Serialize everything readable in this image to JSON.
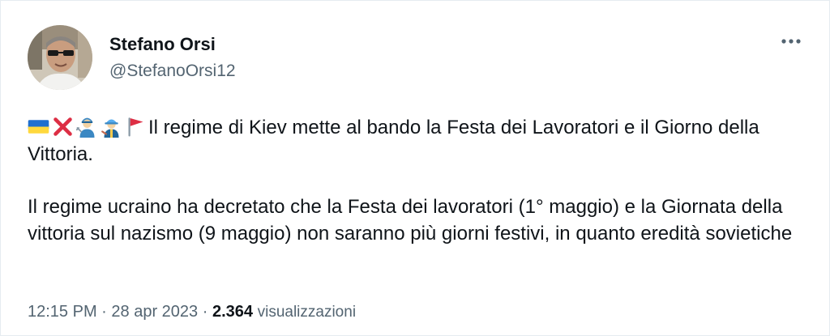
{
  "author": {
    "display_name": "Stefano Orsi",
    "handle": "@StefanoOrsi12"
  },
  "more_label": "•••",
  "tweet": {
    "emojis": [
      "ukraine-flag-emoji",
      "cross-mark-emoji",
      "man-mechanic-emoji",
      "construction-worker-emoji",
      "red-flag-emoji"
    ],
    "paragraph_1": "Il regime di Kiev mette al bando la Festa dei Lavoratori e il Giorno della Vittoria.",
    "paragraph_2": "Il regime ucraino ha decretato che la Festa dei lavoratori (1° maggio) e la Giornata della vittoria sul nazismo (9 maggio) non saranno più giorni festivi, in quanto eredità sovietiche"
  },
  "meta": {
    "time": "12:15 PM",
    "date": "28 apr 2023",
    "separator": "·",
    "views_count": "2.364",
    "views_label": "visualizzazioni"
  },
  "colors": {
    "text_primary": "#0f1419",
    "text_secondary": "#536471",
    "border": "#e6ecf0"
  }
}
